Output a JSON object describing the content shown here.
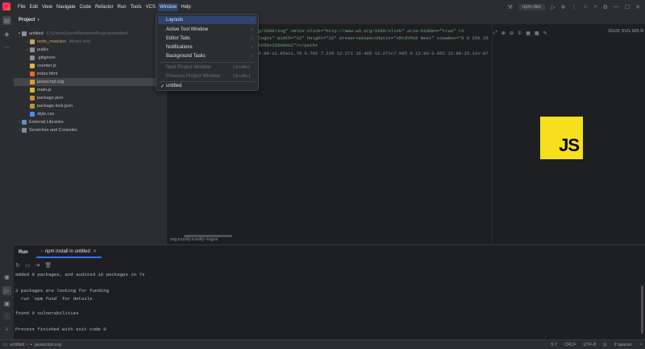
{
  "titlebar": {
    "menu": [
      "File",
      "Edit",
      "View",
      "Navigate",
      "Code",
      "Refactor",
      "Run",
      "Tools",
      "VCS",
      "Window",
      "Help"
    ],
    "active_menu": "Window",
    "run_config": "npm-dev"
  },
  "window_menu": {
    "items": [
      {
        "label": "Layouts",
        "submenu": true,
        "highlighted": true
      },
      {
        "label": "Active Tool Window",
        "submenu": true
      },
      {
        "label": "Editor Tabs",
        "submenu": true
      },
      {
        "label": "Notifications",
        "submenu": true
      },
      {
        "label": "Background Tasks",
        "submenu": true
      },
      {
        "label": "Next Project Window",
        "shortcut": "Ctrl+Alt+]",
        "disabled": true
      },
      {
        "label": "Previous Project Window",
        "shortcut": "Ctrl+Alt+[",
        "disabled": true
      },
      {
        "label": "untitled",
        "checked": true
      }
    ]
  },
  "project": {
    "header": "Project",
    "root": {
      "name": "untitled",
      "path": "C:\\Users\\User\\WebstormProjects\\untitled"
    },
    "items": [
      {
        "name": "node_modules",
        "hint": "library root",
        "type": "folder-mod"
      },
      {
        "name": "public",
        "type": "folder"
      },
      {
        "name": ".gitignore",
        "type": "git"
      },
      {
        "name": "counter.js",
        "type": "js"
      },
      {
        "name": "index.html",
        "type": "html"
      },
      {
        "name": "javascript.svg",
        "type": "svg"
      },
      {
        "name": "main.js",
        "type": "js"
      },
      {
        "name": "package.json",
        "type": "json"
      },
      {
        "name": "package-lock.json",
        "type": "json"
      },
      {
        "name": "style.css",
        "type": "css"
      }
    ],
    "extra": [
      "External Libraries",
      "Scratches and Consoles"
    ]
  },
  "editor": {
    "line1": "rg/2000/svg\" xmlns:xlink=\"http://www.w3.org/1999/xlink\" aria-hidden=\"true\" ro",
    "line2": "-logos\" width=\"32\" height=\"32\" preserveAspectRatio=\"xMidYMid meet\" viewBox=\"0 0 256 25",
    "line3": "0h256v256H0V0Z\"></path>",
    "line4": "19.99-11.85sc1.78 6.701 7.218 12.271 15.465 12.271c7.905 0 12.89-3.952 12.89-15.12v-87",
    "breadcrumb": "svg.iconify.iconify--logos",
    "preview_info": "32x32 SVG 995 B"
  },
  "run_panel": {
    "title": "Run",
    "tab": "npm install in untitled",
    "console": [
      "added 9 packages, and audited 10 packages in 7s",
      "",
      "3 packages are looking for funding",
      "  run `npm fund` for details",
      "",
      "found 0 vulnerabilities",
      "",
      "Process finished with exit code 0"
    ]
  },
  "statusbar": {
    "path": [
      "untitled",
      "javascript.svg"
    ],
    "position": "5:7",
    "line_ending": "CRLF",
    "encoding": "UTF-8",
    "indent": "2 spaces"
  },
  "colors": {
    "accent": "#3574f0",
    "js_logo": "#f7df1e",
    "menu_highlight": "#2e436e"
  }
}
